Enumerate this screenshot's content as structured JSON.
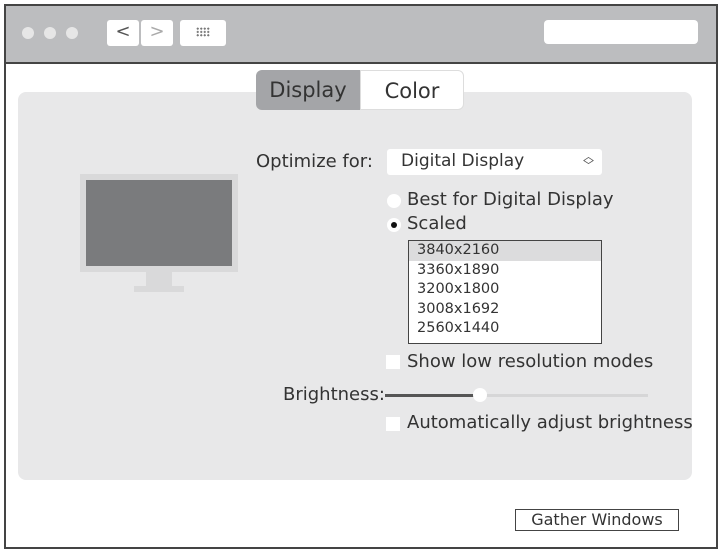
{
  "tabs": [
    {
      "label": "Display",
      "selected": true
    },
    {
      "label": "Color",
      "selected": false
    }
  ],
  "nav": {
    "back": "<",
    "forward": ">"
  },
  "optimize": {
    "label": "Optimize for:",
    "value": "Digital Display"
  },
  "resolution": {
    "options": [
      {
        "label": "Best for Digital Display",
        "selected": false
      },
      {
        "label": "Scaled",
        "selected": true
      }
    ],
    "modes": [
      "3840x2160",
      "3360x1890",
      "3200x1800",
      "3008x1692",
      "2560x1440"
    ],
    "selected_mode": "3840x2160"
  },
  "low_res": {
    "label": "Show low resolution modes",
    "checked": false
  },
  "brightness": {
    "label": "Brightness:",
    "value_percent": 36
  },
  "auto_brightness": {
    "label": "Automatically adjust brightness",
    "checked": false
  },
  "gather_button": "Gather Windows"
}
